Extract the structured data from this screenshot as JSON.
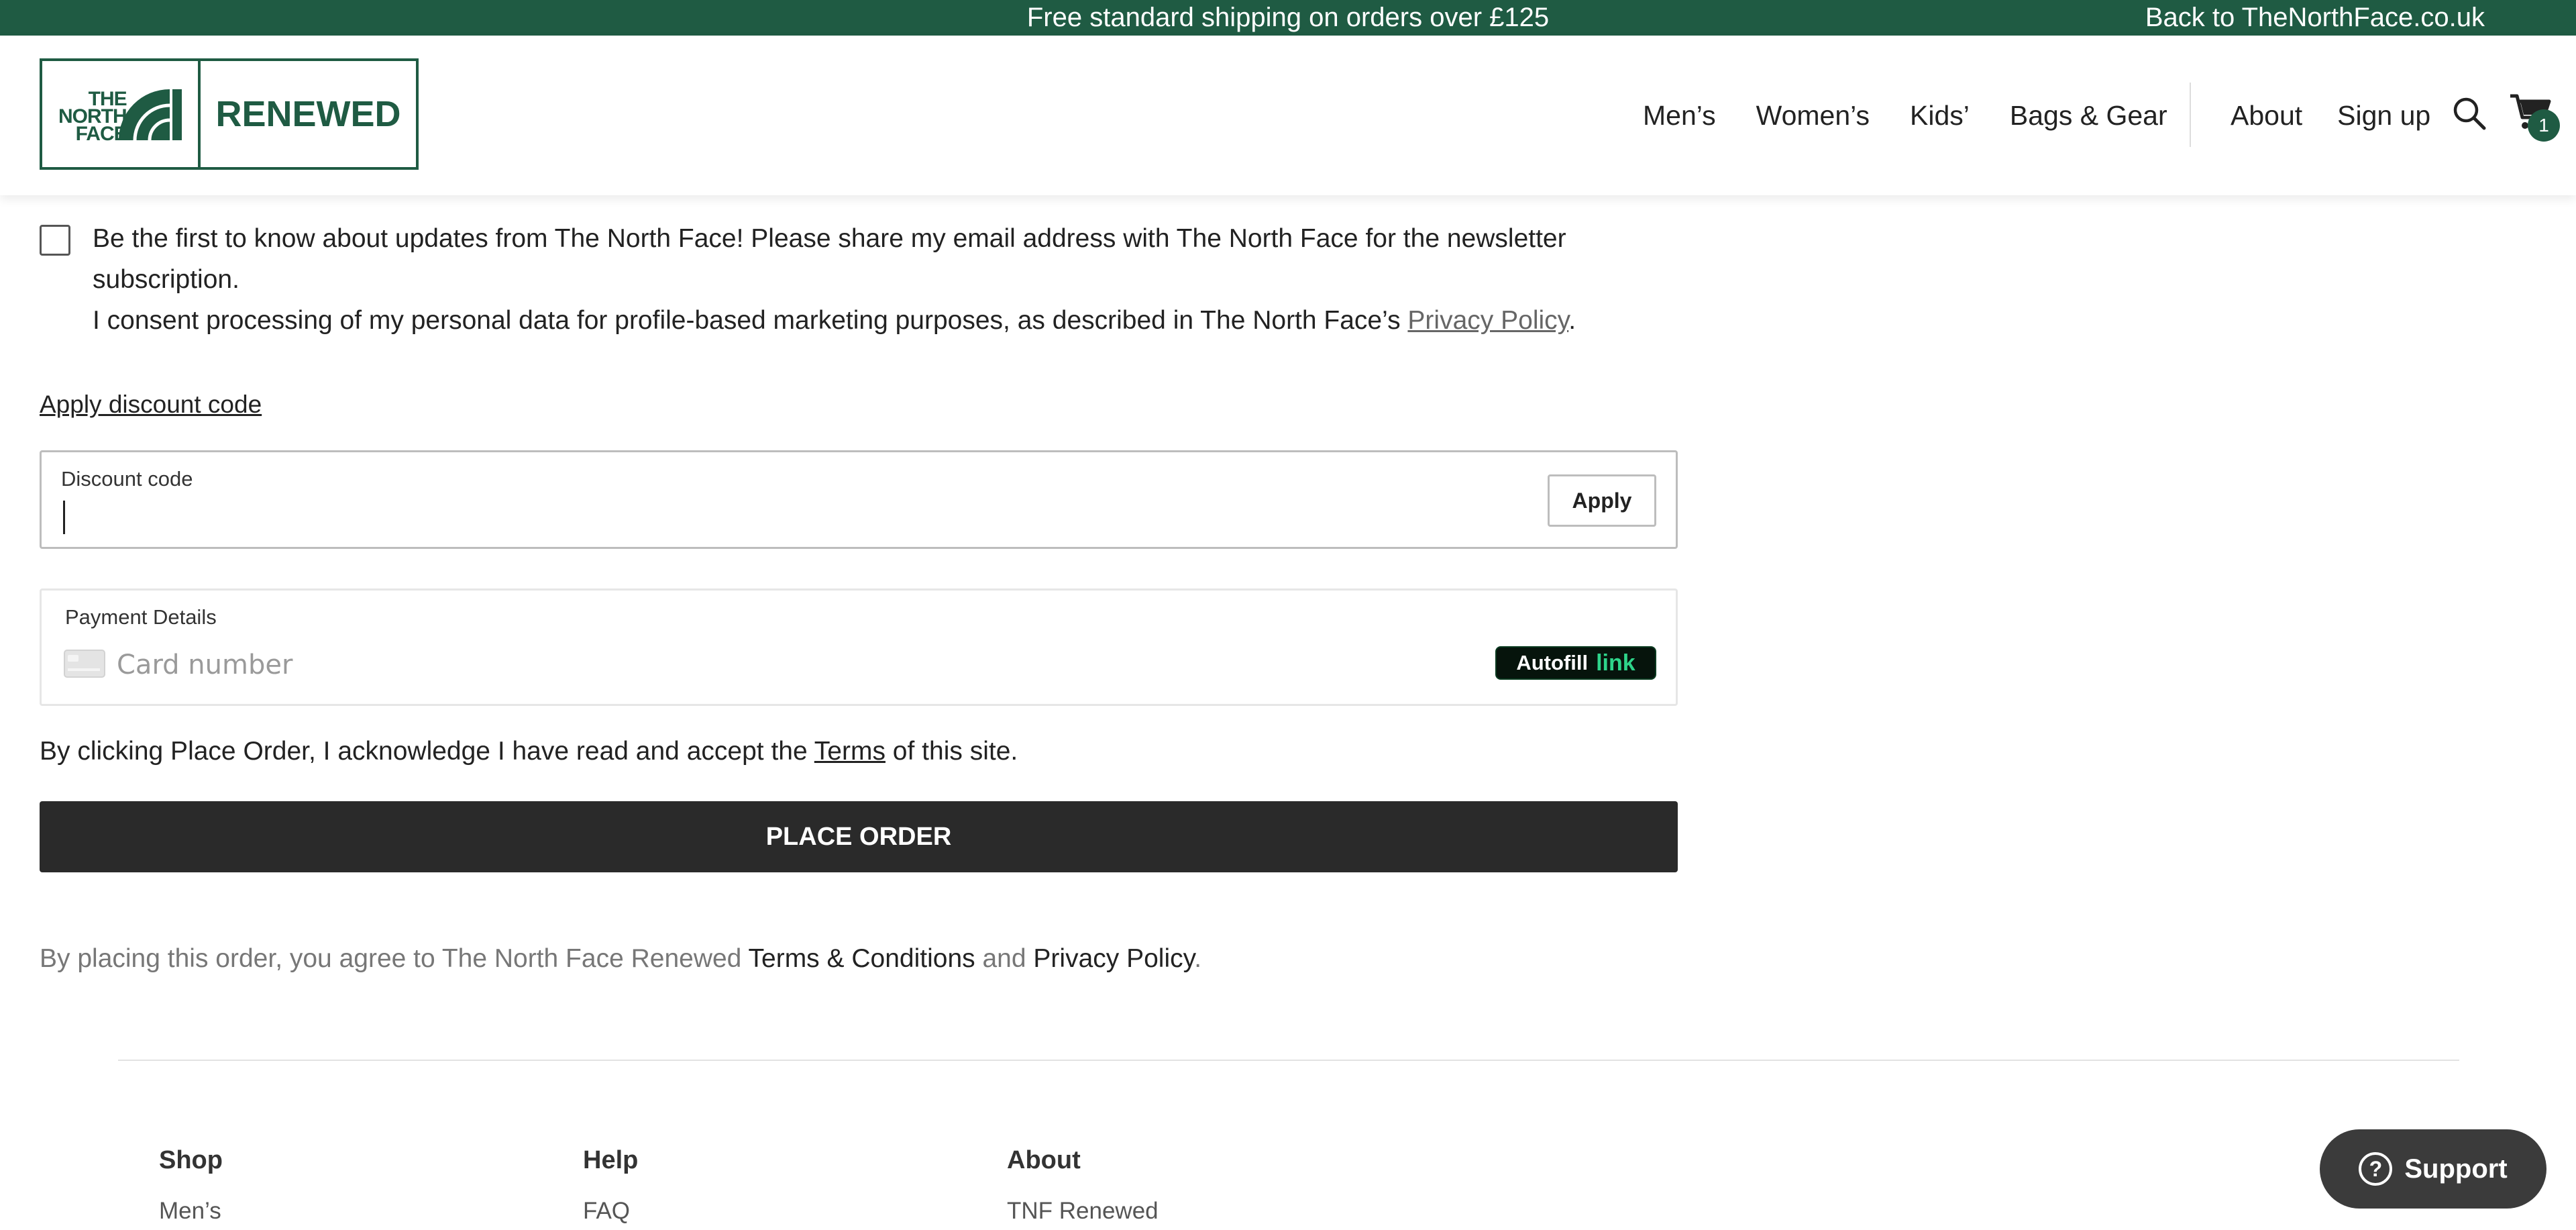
{
  "topbar": {
    "promo": "Free standard shipping on orders over £125",
    "back_link": "Back to TheNorthFace.co.uk"
  },
  "header": {
    "logo": {
      "line1": "THE",
      "line2": "NORTH",
      "line3": "FACE",
      "brand": "RENEWED"
    },
    "nav_main": [
      "Men’s",
      "Women’s",
      "Kids’",
      "Bags & Gear"
    ],
    "nav_secondary": [
      "About",
      "Sign up"
    ],
    "cart_count": "1",
    "icons": {
      "search": "search-icon",
      "cart": "cart-icon"
    }
  },
  "consent": {
    "line1": "Be the first to know about updates from The North Face! Please share my email address with The North Face for the newsletter subscription.",
    "line2_prefix": "I consent processing of my personal data for profile-based marketing purposes, as described in The North Face’s ",
    "privacy_link": "Privacy Policy",
    "line2_suffix": ".",
    "checked": false
  },
  "discount": {
    "toggle_link": "Apply discount code",
    "label": "Discount code",
    "value": "",
    "apply_label": "Apply"
  },
  "payment": {
    "label": "Payment Details",
    "card_placeholder": "Card number",
    "autofill_label": "Autofill",
    "autofill_brand": "link"
  },
  "acknowledge": {
    "prefix": "By clicking Place Order, I acknowledge I have read and accept the ",
    "terms": "Terms",
    "suffix": " of this site."
  },
  "place_order_label": "PLACE ORDER",
  "agreement": {
    "prefix": "By placing this order, you agree to The North Face Renewed ",
    "terms": "Terms & Conditions",
    "middle": " and ",
    "privacy": "Privacy Policy",
    "suffix": "."
  },
  "footer": {
    "shop": {
      "heading": "Shop",
      "first_item": "Men’s"
    },
    "help": {
      "heading": "Help",
      "first_item": "FAQ"
    },
    "about": {
      "heading": "About",
      "first_item": "TNF Renewed"
    }
  },
  "support_label": "Support",
  "colors": {
    "brand_green": "#1f5b43",
    "button_dark": "#2a2a2a",
    "link_green": "#2ed48a"
  }
}
